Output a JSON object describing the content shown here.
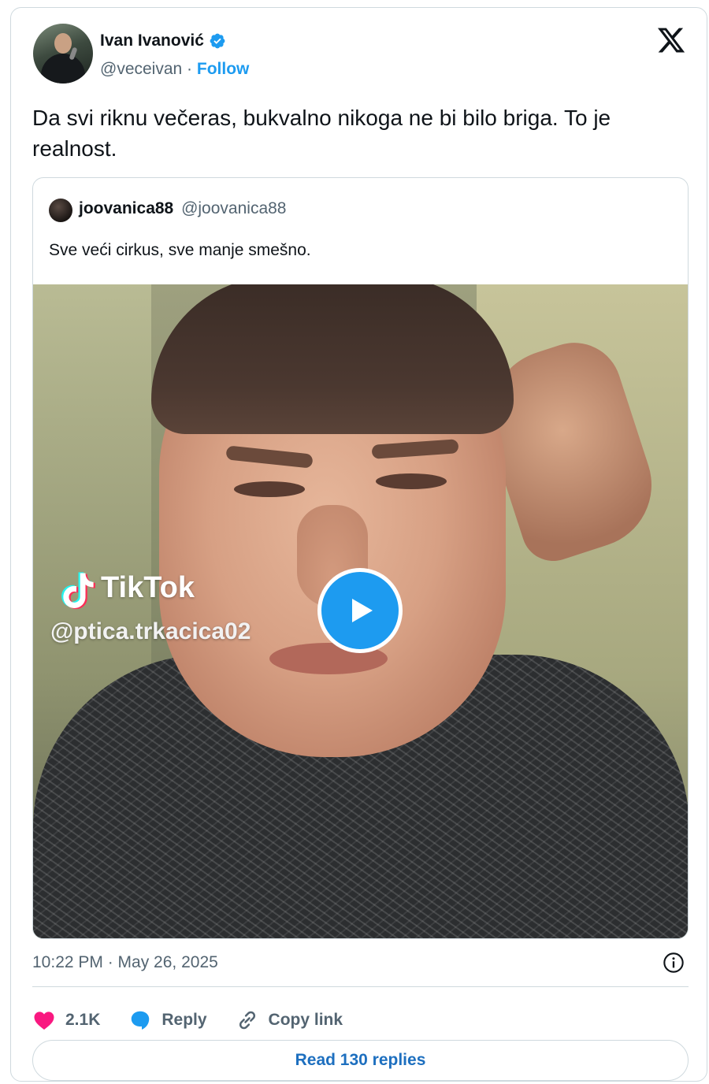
{
  "author": {
    "name": "Ivan Ivanović",
    "handle": "@veceivan",
    "separator": "·",
    "follow_label": "Follow"
  },
  "tweet": {
    "text": "Da svi riknu večeras, bukvalno nikoga ne bi bilo briga. To je realnost."
  },
  "quoted": {
    "name": "joovanica88",
    "handle": "@joovanica88",
    "text": "Sve veći cirkus, sve manje smešno.",
    "media": {
      "watermark_brand": "TikTok",
      "watermark_user": "@ptica.trkacica02",
      "play_icon": "play-icon"
    }
  },
  "meta": {
    "timestamp": "10:22 PM · May 26, 2025"
  },
  "actions": {
    "like_count": "2.1K",
    "reply_label": "Reply",
    "copy_label": "Copy link"
  },
  "footer": {
    "read_replies_label": "Read 130 replies"
  },
  "colors": {
    "accent": "#1d9bf0",
    "like": "#f91880",
    "text_secondary": "#536471",
    "border": "#cfd9de"
  },
  "icons": [
    "verified-badge-icon",
    "x-logo-icon",
    "play-icon",
    "info-icon",
    "heart-icon",
    "reply-bubble-icon",
    "link-icon",
    "tiktok-logo-icon"
  ]
}
